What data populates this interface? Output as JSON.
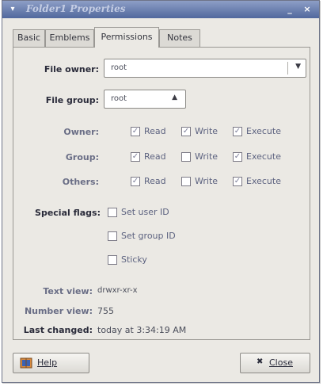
{
  "window": {
    "title": "Folder1 Properties",
    "minimize_glyph": "_",
    "close_glyph": "×",
    "menu_glyph": "▾"
  },
  "tabs": [
    {
      "label": "Basic"
    },
    {
      "label": "Emblems"
    },
    {
      "label": "Permissions",
      "active": true
    },
    {
      "label": "Notes"
    }
  ],
  "permissions": {
    "file_owner_label": "File owner:",
    "file_owner_value": "root",
    "file_group_label": "File group:",
    "file_group_value": "root",
    "rows": [
      {
        "label": "Owner:",
        "read": "Read",
        "write": "Write",
        "execute": "Execute",
        "read_checked": true,
        "write_checked": true,
        "execute_checked": true
      },
      {
        "label": "Group:",
        "read": "Read",
        "write": "Write",
        "execute": "Execute",
        "read_checked": true,
        "write_checked": false,
        "execute_checked": true
      },
      {
        "label": "Others:",
        "read": "Read",
        "write": "Write",
        "execute": "Execute",
        "read_checked": true,
        "write_checked": false,
        "execute_checked": true
      }
    ],
    "special_flags_label": "Special flags:",
    "special_flags": [
      {
        "label": "Set user ID",
        "checked": false
      },
      {
        "label": "Set group ID",
        "checked": false
      },
      {
        "label": "Sticky",
        "checked": false
      }
    ],
    "text_view_label": "Text view:",
    "text_view_value": "drwxr-xr-x",
    "number_view_label": "Number view:",
    "number_view_value": "755",
    "last_changed_label": "Last changed:",
    "last_changed_value": "today at 3:34:19 AM"
  },
  "buttons": {
    "help": "Help",
    "close": "Close",
    "close_glyph": "✖"
  },
  "colors": {
    "titlebar": "#51689d",
    "window_bg": "#ebe9e4",
    "check_mark": "#7d7f99"
  }
}
